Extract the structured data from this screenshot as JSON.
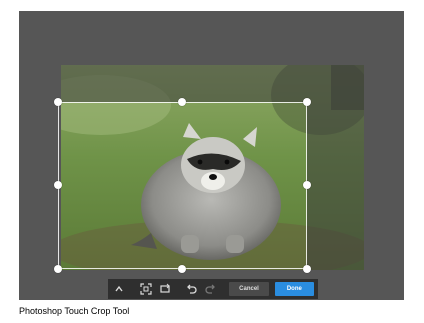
{
  "toolbar": {
    "cancel_label": "Cancel",
    "done_label": "Done",
    "icons": [
      "chevron-up-icon",
      "auto-crop-icon",
      "rotate-crop-icon",
      "undo-icon",
      "redo-icon"
    ]
  },
  "caption": "Photoshop Touch Crop Tool",
  "colors": {
    "accent": "#2a8de0",
    "stage": "#565656",
    "toolbar": "#2f2f2f"
  }
}
